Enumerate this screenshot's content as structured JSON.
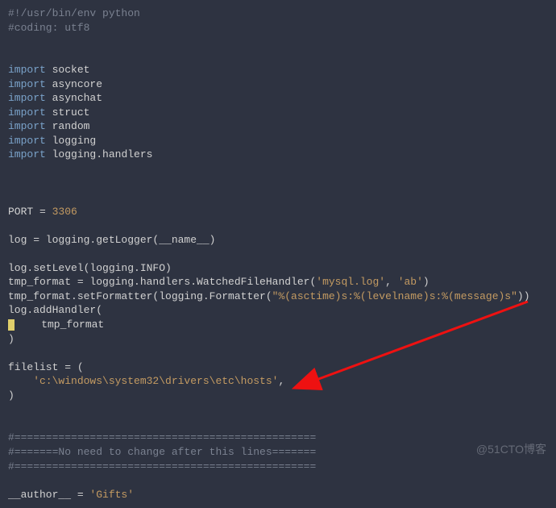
{
  "code": {
    "l1": "#!/usr/bin/env python",
    "l2": "#coding: utf8",
    "importKw": "import",
    "imp1": "socket",
    "imp2": "asyncore",
    "imp3": "asynchat",
    "imp4": "struct",
    "imp5": "random",
    "imp6": "logging",
    "imp7": "logging.handlers",
    "portLabel": "PORT = ",
    "portVal": "3306",
    "logAssign": "log = logging.getLogger(__name__)",
    "setLevel": "log.setLevel(logging.INFO)",
    "tmpFmt1a": "tmp_format = logging.handlers.WatchedFileHandler(",
    "tmpFmt1s1": "'mysql.log'",
    "tmpFmt1mid": ", ",
    "tmpFmt1s2": "'ab'",
    "tmpFmt1b": ")",
    "tmpFmt2a": "tmp_format.setFormatter(logging.Formatter(",
    "tmpFmt2s": "\"%(asctime)s:%(levelname)s:%(message)s\"",
    "tmpFmt2b": "))",
    "addH": "log.addHandler(",
    "addHarg": "    tmp_format",
    "close": ")",
    "filelist": "filelist = (",
    "filepath": "    'c:\\windows\\system32\\drivers\\etc\\hosts'",
    "filecomma": ",",
    "sep1": "#================================================",
    "sep2": "#=======No need to change after this lines=======",
    "sep3": "#================================================",
    "authorA": "__author__ = ",
    "authorS": "'Gifts'"
  },
  "watermark": "@51CTO博客"
}
